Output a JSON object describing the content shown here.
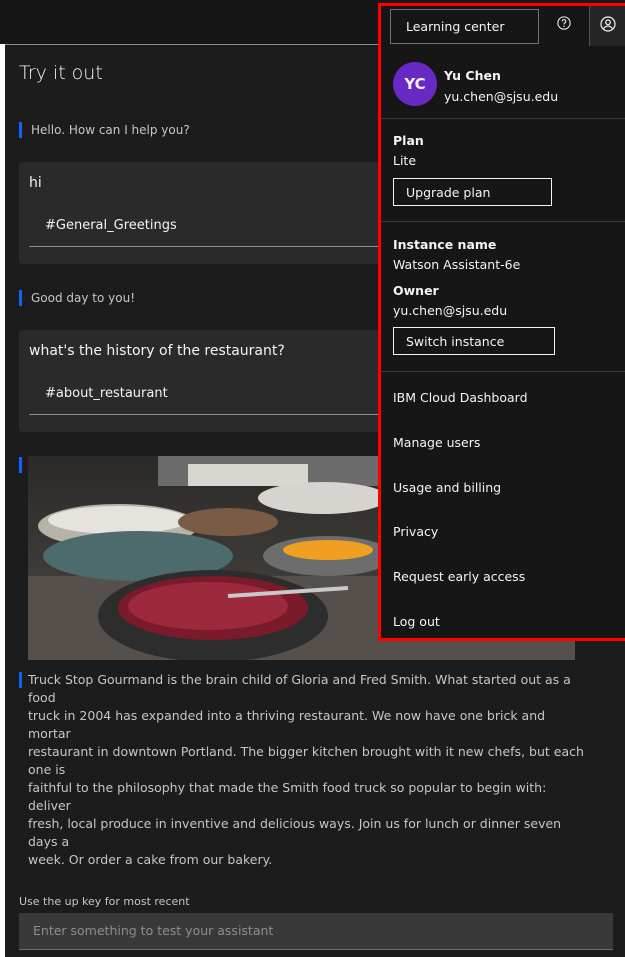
{
  "chat": {
    "title": "Try it out",
    "messages": [
      {
        "role": "bot",
        "text": "Hello. How can I help you?"
      },
      {
        "role": "user",
        "text": "hi",
        "intent": "#General_Greetings"
      },
      {
        "role": "bot",
        "text": "Good day to you!"
      },
      {
        "role": "user",
        "text": "what's the history of the restaurant?",
        "intent": "#about_restaurant"
      },
      {
        "role": "bot",
        "image": "restaurant buffet photo"
      },
      {
        "role": "bot",
        "lines": [
          "Truck Stop Gourmand is the brain child of Gloria and Fred Smith. What started out as a food",
          "truck in 2004 has expanded into a thriving restaurant. We now have one brick and mortar",
          "restaurant in downtown Portland. The bigger kitchen brought with it new chefs, but each one is",
          "faithful to the philosophy that made the Smith food truck so popular to begin with: deliver",
          "fresh, local produce in inventive and delicious ways. Join us for lunch or dinner seven days a",
          "week. Or order a cake from our bakery."
        ]
      }
    ],
    "hint": "Use the up key for most recent",
    "input_placeholder": "Enter something to test your assistant"
  },
  "header": {
    "learning_center": "Learning center",
    "help_icon": "help-icon",
    "user_icon": "user-avatar-icon"
  },
  "user_menu": {
    "initials": "YC",
    "name": "Yu Chen",
    "email": "yu.chen@sjsu.edu",
    "plan_label": "Plan",
    "plan_value": "Lite",
    "upgrade_label": "Upgrade plan",
    "instance_label": "Instance name",
    "instance_value": "Watson Assistant-6e",
    "owner_label": "Owner",
    "owner_value": "yu.chen@sjsu.edu",
    "switch_label": "Switch instance",
    "items": [
      "IBM Cloud Dashboard",
      "Manage users",
      "Usage and billing",
      "Privacy",
      "Request early access",
      "Log out"
    ]
  },
  "colors": {
    "accent": "#0f62fe",
    "avatar": "#6929c4",
    "highlight": "#ff0000"
  }
}
